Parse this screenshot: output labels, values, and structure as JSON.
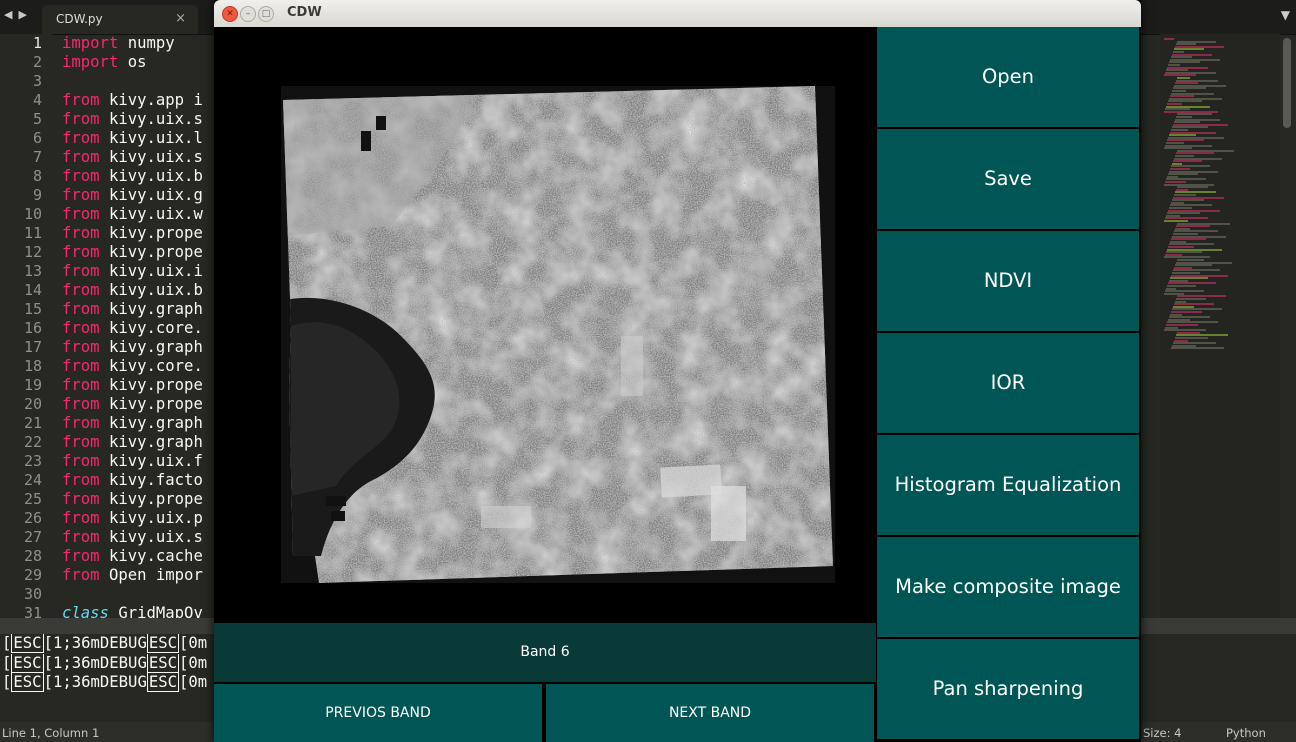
{
  "editor": {
    "tab_title": "CDW.py",
    "tab_close": "×",
    "lines": [
      {
        "n": "1",
        "k": "import",
        "r": " numpy"
      },
      {
        "n": "2",
        "k": "import",
        "r": " os"
      },
      {
        "n": "3",
        "k": "",
        "r": ""
      },
      {
        "n": "4",
        "k": "from",
        "r": " kivy.app i"
      },
      {
        "n": "5",
        "k": "from",
        "r": " kivy.uix.s"
      },
      {
        "n": "6",
        "k": "from",
        "r": " kivy.uix.l"
      },
      {
        "n": "7",
        "k": "from",
        "r": " kivy.uix.s"
      },
      {
        "n": "8",
        "k": "from",
        "r": " kivy.uix.b"
      },
      {
        "n": "9",
        "k": "from",
        "r": " kivy.uix.g"
      },
      {
        "n": "10",
        "k": "from",
        "r": " kivy.uix.w"
      },
      {
        "n": "11",
        "k": "from",
        "r": " kivy.prope"
      },
      {
        "n": "12",
        "k": "from",
        "r": " kivy.prope"
      },
      {
        "n": "13",
        "k": "from",
        "r": " kivy.uix.i"
      },
      {
        "n": "14",
        "k": "from",
        "r": " kivy.uix.b"
      },
      {
        "n": "15",
        "k": "from",
        "r": " kivy.graph"
      },
      {
        "n": "16",
        "k": "from",
        "r": " kivy.core."
      },
      {
        "n": "17",
        "k": "from",
        "r": " kivy.graph"
      },
      {
        "n": "18",
        "k": "from",
        "r": " kivy.core."
      },
      {
        "n": "19",
        "k": "from",
        "r": " kivy.prope"
      },
      {
        "n": "20",
        "k": "from",
        "r": " kivy.prope"
      },
      {
        "n": "21",
        "k": "from",
        "r": " kivy.graph"
      },
      {
        "n": "22",
        "k": "from",
        "r": " kivy.graph"
      },
      {
        "n": "23",
        "k": "from",
        "r": " kivy.uix.f"
      },
      {
        "n": "24",
        "k": "from",
        "r": " kivy.facto"
      },
      {
        "n": "25",
        "k": "from",
        "r": " kivy.prope"
      },
      {
        "n": "26",
        "k": "from",
        "r": " kivy.uix.p"
      },
      {
        "n": "27",
        "k": "from",
        "r": " kivy.uix.s"
      },
      {
        "n": "28",
        "k": "from",
        "r": " kivy.cache"
      },
      {
        "n": "29",
        "k": "from",
        "r": " Open impor"
      },
      {
        "n": "30",
        "k": "",
        "r": ""
      },
      {
        "n": "31",
        "k": "class",
        "r": " GridMapOv"
      }
    ],
    "console_lines": [
      {
        "esc": "ESC",
        "mid": "[1;36mDEBUG",
        "esc2": "ESC",
        "tail": "[0m"
      },
      {
        "esc": "ESC",
        "mid": "[1;36mDEBUG",
        "esc2": "ESC",
        "tail": "[0m"
      },
      {
        "esc": "ESC",
        "mid": "[1;36mDEBUG",
        "esc2": "ESC",
        "tail": "[0m"
      }
    ],
    "status_position": "Line 1, Column 1",
    "status_tab_size": "Size: 4",
    "status_syntax": "Python"
  },
  "app_window": {
    "title": "CDW",
    "band_label": "Band 6",
    "prev_band_button": "PREVIOS BAND",
    "next_band_button": "NEXT BAND",
    "side_buttons": [
      "Open",
      "Save",
      "NDVI",
      "IOR",
      "Histogram Equalization",
      "Make composite image",
      "Pan sharpening"
    ]
  },
  "colors": {
    "button_teal": "#005655",
    "band_label_bg": "#0a3a38",
    "editor_bg": "#272822",
    "keyword_pink": "#f92672"
  }
}
